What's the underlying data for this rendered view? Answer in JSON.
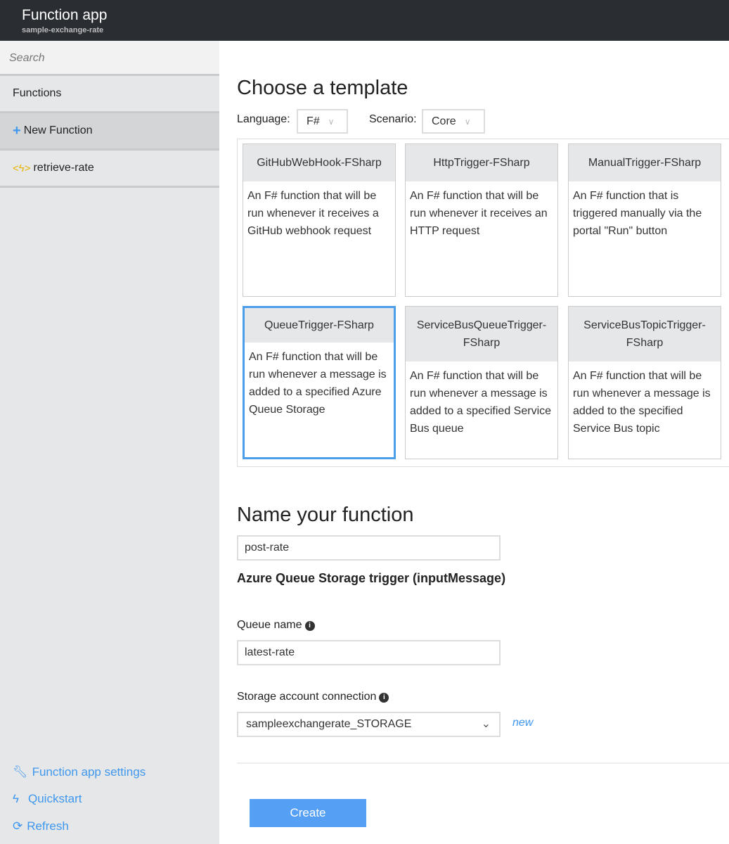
{
  "header": {
    "title": "Function app",
    "subtitle": "sample-exchange-rate"
  },
  "sidebar": {
    "search_placeholder": "Search",
    "items": [
      {
        "label": "Functions"
      },
      {
        "label": "New Function",
        "icon": "plus-icon"
      },
      {
        "label": "retrieve-rate",
        "icon": "function-icon"
      }
    ],
    "footer": [
      {
        "label": "Function app settings",
        "icon": "wrench-icon"
      },
      {
        "label": "Quickstart",
        "icon": "bolt-icon"
      },
      {
        "label": "Refresh",
        "icon": "refresh-icon"
      }
    ]
  },
  "main": {
    "title": "Choose a template",
    "language_label": "Language:",
    "language_value": "F#",
    "scenario_label": "Scenario:",
    "scenario_value": "Core",
    "templates": [
      {
        "name": "GitHubWebHook-FSharp",
        "desc": "An F# function that will be run whenever it receives a GitHub webhook request"
      },
      {
        "name": "HttpTrigger-FSharp",
        "desc": "An F# function that will be run whenever it receives an HTTP request"
      },
      {
        "name": "ManualTrigger-FSharp",
        "desc": "An F# function that is triggered manually via the portal \"Run\" button"
      },
      {
        "name": "QueueTrigger-FSharp",
        "desc": "An F# function that will be run whenever a message is added to a specified Azure Queue Storage",
        "selected": true
      },
      {
        "name": "ServiceBusQueueTrigger-FSharp",
        "desc": "An F# function that will be run whenever a message is added to a specified Service Bus queue"
      },
      {
        "name": "ServiceBusTopicTrigger-FSharp",
        "desc": "An F# function that will be run whenever a message is added to the specified Service Bus topic"
      }
    ],
    "name_title": "Name your function",
    "name_value": "post-rate",
    "trigger_title": "Azure Queue Storage trigger (inputMessage)",
    "queue_label": "Queue name",
    "queue_value": "latest-rate",
    "storage_label": "Storage account connection",
    "storage_value": "sampleexchangerate_STORAGE",
    "new_link": "new",
    "create_label": "Create"
  },
  "colors": {
    "accent": "#55a0f4",
    "header_bg": "#2a2e33",
    "selected_border": "#4a9eea"
  }
}
